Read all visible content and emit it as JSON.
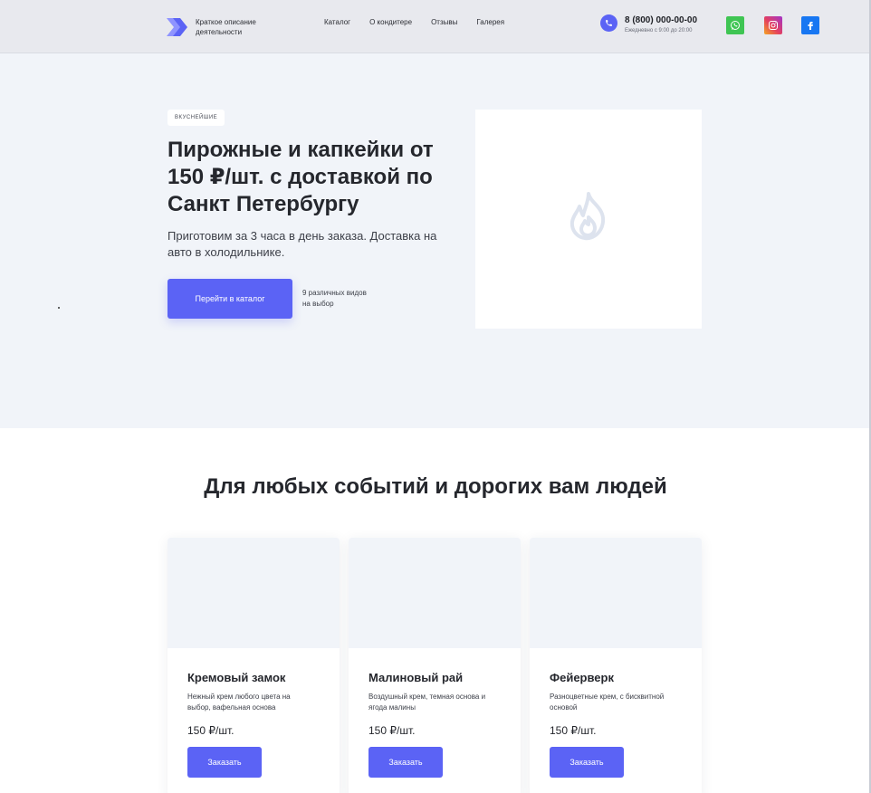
{
  "header": {
    "tagline": "Краткое описание деятельности",
    "nav": [
      "Каталог",
      "О кондитере",
      "Отзывы",
      "Галерея"
    ],
    "phone": "8 (800) 000-00-00",
    "hours": "Ежедневно с 9:00 до 20:00",
    "socials": [
      "whatsapp-icon",
      "instagram-icon",
      "facebook-icon"
    ]
  },
  "hero": {
    "badge": "ВКУСНЕЙШИЕ",
    "title": "Пирожные и капкейки от 150 ₽/шт. с доставкой по Санкт Петербургу",
    "subtitle": "Приготовим за 3 часа в день заказа. Доставка на авто в холодильнике.",
    "cta_label": "Перейти в каталог",
    "cta_note": "9 различных видов на выбор",
    "image_icon": "flame-icon"
  },
  "section": {
    "title": "Для любых событий и дорогих вам людей"
  },
  "cards": [
    {
      "name": "Кремовый замок",
      "description": "Нежный крем любого цвета на выбор, вафельная основа",
      "price": "150 ₽/шт.",
      "button": "Заказать"
    },
    {
      "name": "Малиновый рай",
      "description": "Воздушный крем, темная основа и ягода малины",
      "price": "150 ₽/шт.",
      "button": "Заказать"
    },
    {
      "name": "Фейерверк",
      "description": "Разноцветные крем, с бисквитной основой",
      "price": "150 ₽/шт.",
      "button": "Заказать"
    }
  ],
  "colors": {
    "accent": "#5b63f5",
    "header_bg": "#e8e9ee",
    "hero_bg": "#f1f4f9",
    "whatsapp": "#3fc553",
    "facebook": "#1877f2"
  }
}
